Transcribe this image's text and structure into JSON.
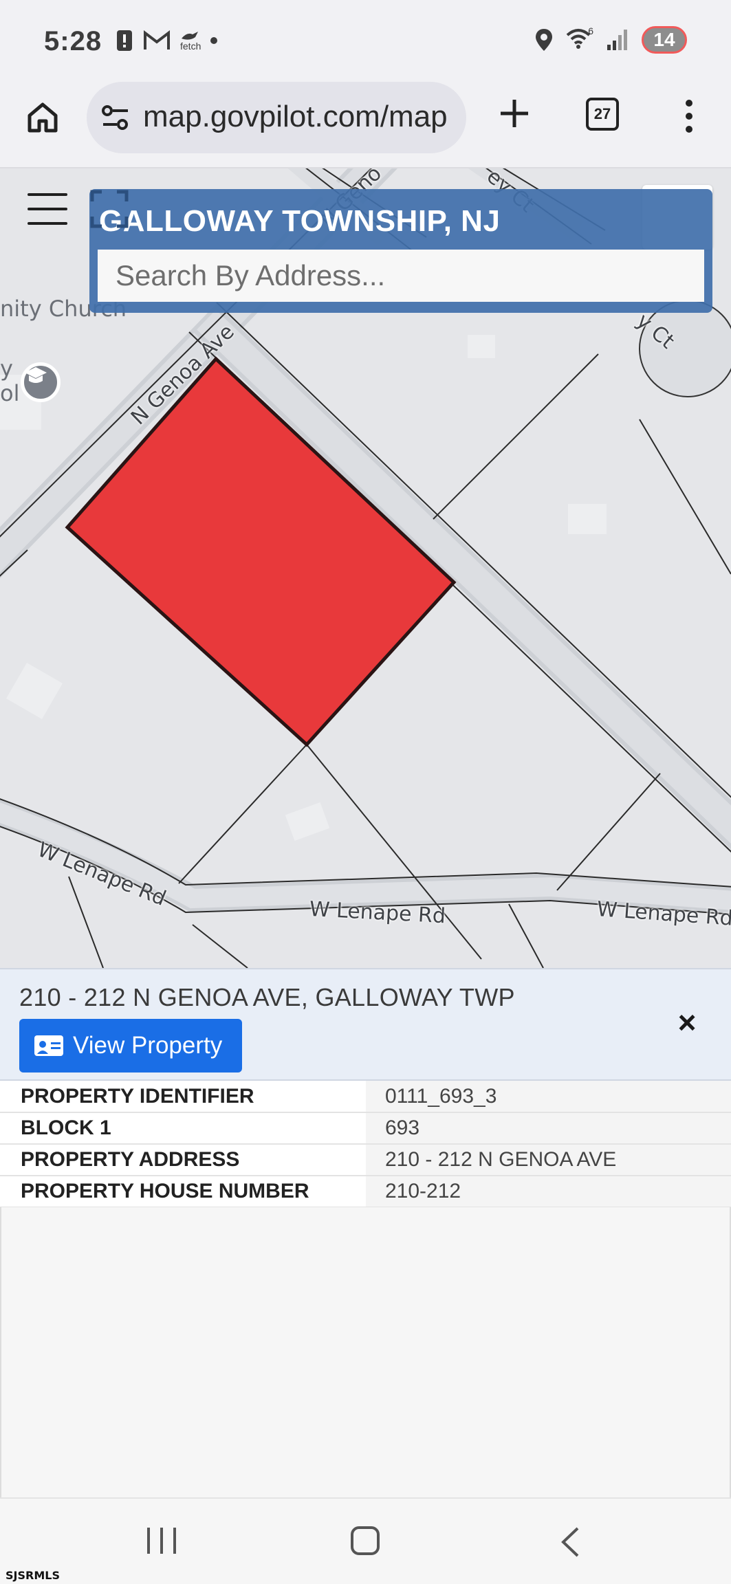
{
  "status_bar": {
    "time": "5:28",
    "left_icons": [
      "alert-icon",
      "gmail-icon",
      "fetch-icon",
      "dot-icon"
    ],
    "fetch_label": "fetch",
    "right_icons": [
      "location-icon",
      "wifi-icon",
      "signal-icon"
    ],
    "wifi_label": "6",
    "battery": "14"
  },
  "browser": {
    "url": "map.govpilot.com/map",
    "tab_count": "27"
  },
  "map": {
    "header_title": "GALLOWAY TOWNSHIP, NJ",
    "search_placeholder": "Search By Address...",
    "parcel_color": "#e8393b",
    "labels": {
      "church": "nity Church",
      "school_line1": "y",
      "school_line2": "ol",
      "genoa": "N Genoa Ave",
      "lenape_left": "W Lenape Rd",
      "lenape_mid": "W Lenape Rd",
      "lenape_right": "W Lenape Rd",
      "top_genoa": "N Geno",
      "top_ct": "ey Ct",
      "right_ct": "y Ct"
    }
  },
  "info": {
    "address": "210 - 212 N GENOA AVE, GALLOWAY TWP",
    "view_button": "View Property",
    "close_symbol": "×",
    "rows": [
      {
        "key": "PROPERTY IDENTIFIER",
        "value": "0111_693_3"
      },
      {
        "key": "BLOCK 1",
        "value": "693"
      },
      {
        "key": "PROPERTY ADDRESS",
        "value": "210 - 212 N GENOA AVE"
      },
      {
        "key": "PROPERTY HOUSE NUMBER",
        "value": "210-212"
      }
    ]
  },
  "watermark": "SJSRMLS"
}
